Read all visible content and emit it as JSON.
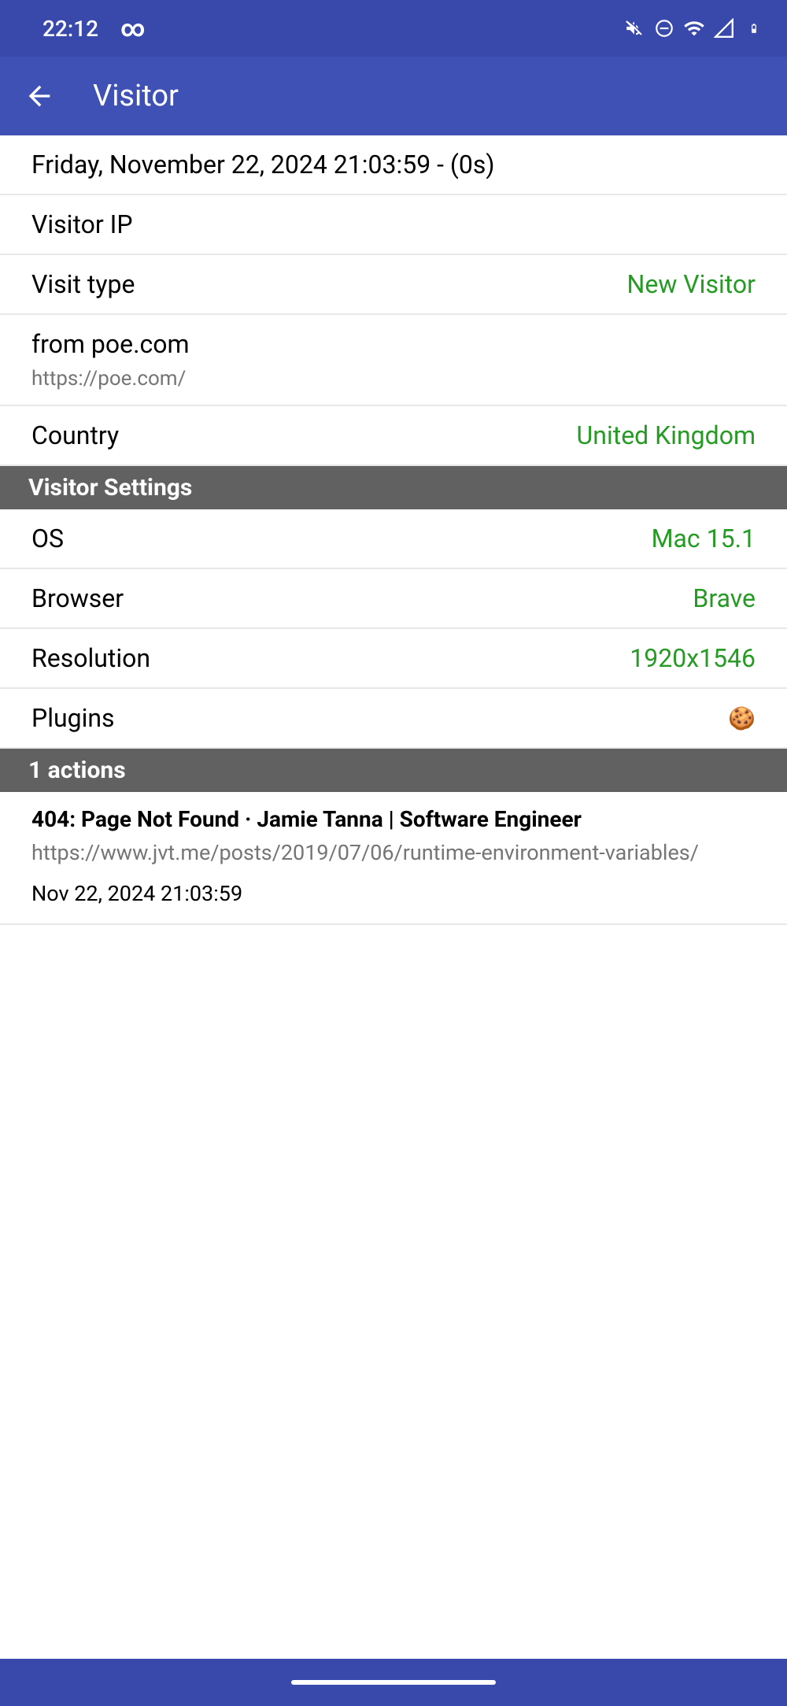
{
  "statusBar": {
    "time": "22:12",
    "infinity": "∞"
  },
  "appBar": {
    "title": "Visitor"
  },
  "visitInfo": {
    "timestamp": "Friday, November 22, 2024 21:03:59 - (0s)",
    "ipLabel": "Visitor IP",
    "ipValue": "",
    "visitTypeLabel": "Visit type",
    "visitTypeValue": "New Visitor",
    "referrerLabel": "from poe.com",
    "referrerUrl": "https://poe.com/",
    "countryLabel": "Country",
    "countryValue": "United Kingdom"
  },
  "sections": {
    "visitorSettings": "Visitor Settings",
    "actions": "1 actions"
  },
  "settings": {
    "osLabel": "OS",
    "osValue": "Mac 15.1",
    "browserLabel": "Browser",
    "browserValue": "Brave",
    "resolutionLabel": "Resolution",
    "resolutionValue": "1920x1546",
    "pluginsLabel": "Plugins",
    "pluginsIcon": "🍪"
  },
  "action": {
    "title": "404: Page Not Found · Jamie Tanna | Software Engineer",
    "url": "https://www.jvt.me/posts/2019/07/06/runtime-environment-variables/",
    "time": "Nov 22, 2024 21:03:59"
  }
}
